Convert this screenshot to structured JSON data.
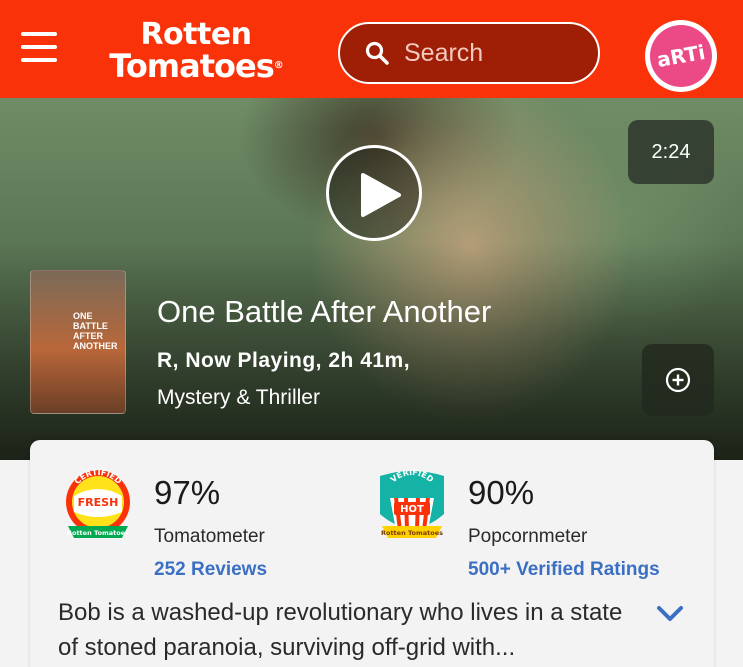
{
  "header": {
    "logo_line1": "Rotten",
    "logo_line2": "Tomatoes",
    "logo_reg": "®",
    "search_placeholder": "Search",
    "avatar_text": "aRTi",
    "brand_color": "#fa320a",
    "icons": [
      "menu-icon",
      "search-icon"
    ]
  },
  "hero": {
    "duration": "2:24",
    "title": "One Battle After Another",
    "meta_line1": "R, Now Playing, 2h 41m,",
    "meta_line2": "Mystery & Thriller",
    "poster_text": "ONE BATTLE AFTER ANOTHER",
    "icons": [
      "play-icon",
      "plus-circle-icon"
    ]
  },
  "scores": {
    "tomatometer": {
      "value": "97%",
      "label": "Tomatometer",
      "link": "252 Reviews",
      "badge_top": "CERTIFIED",
      "badge_mid": "FRESH",
      "badge_bottom": "Rotten Tomatoes"
    },
    "popcornmeter": {
      "value": "90%",
      "label": "Popcornmeter",
      "link": "500+ Verified Ratings",
      "badge_top": "VERIFIED",
      "badge_mid": "HOT",
      "badge_bottom": "Rotten Tomatoes"
    },
    "link_color": "#3b6fc4"
  },
  "synopsis": {
    "text": "Bob is a washed-up revolutionary who lives in a state of stoned paranoia, surviving off-grid with...",
    "icon": "chevron-down-icon"
  }
}
